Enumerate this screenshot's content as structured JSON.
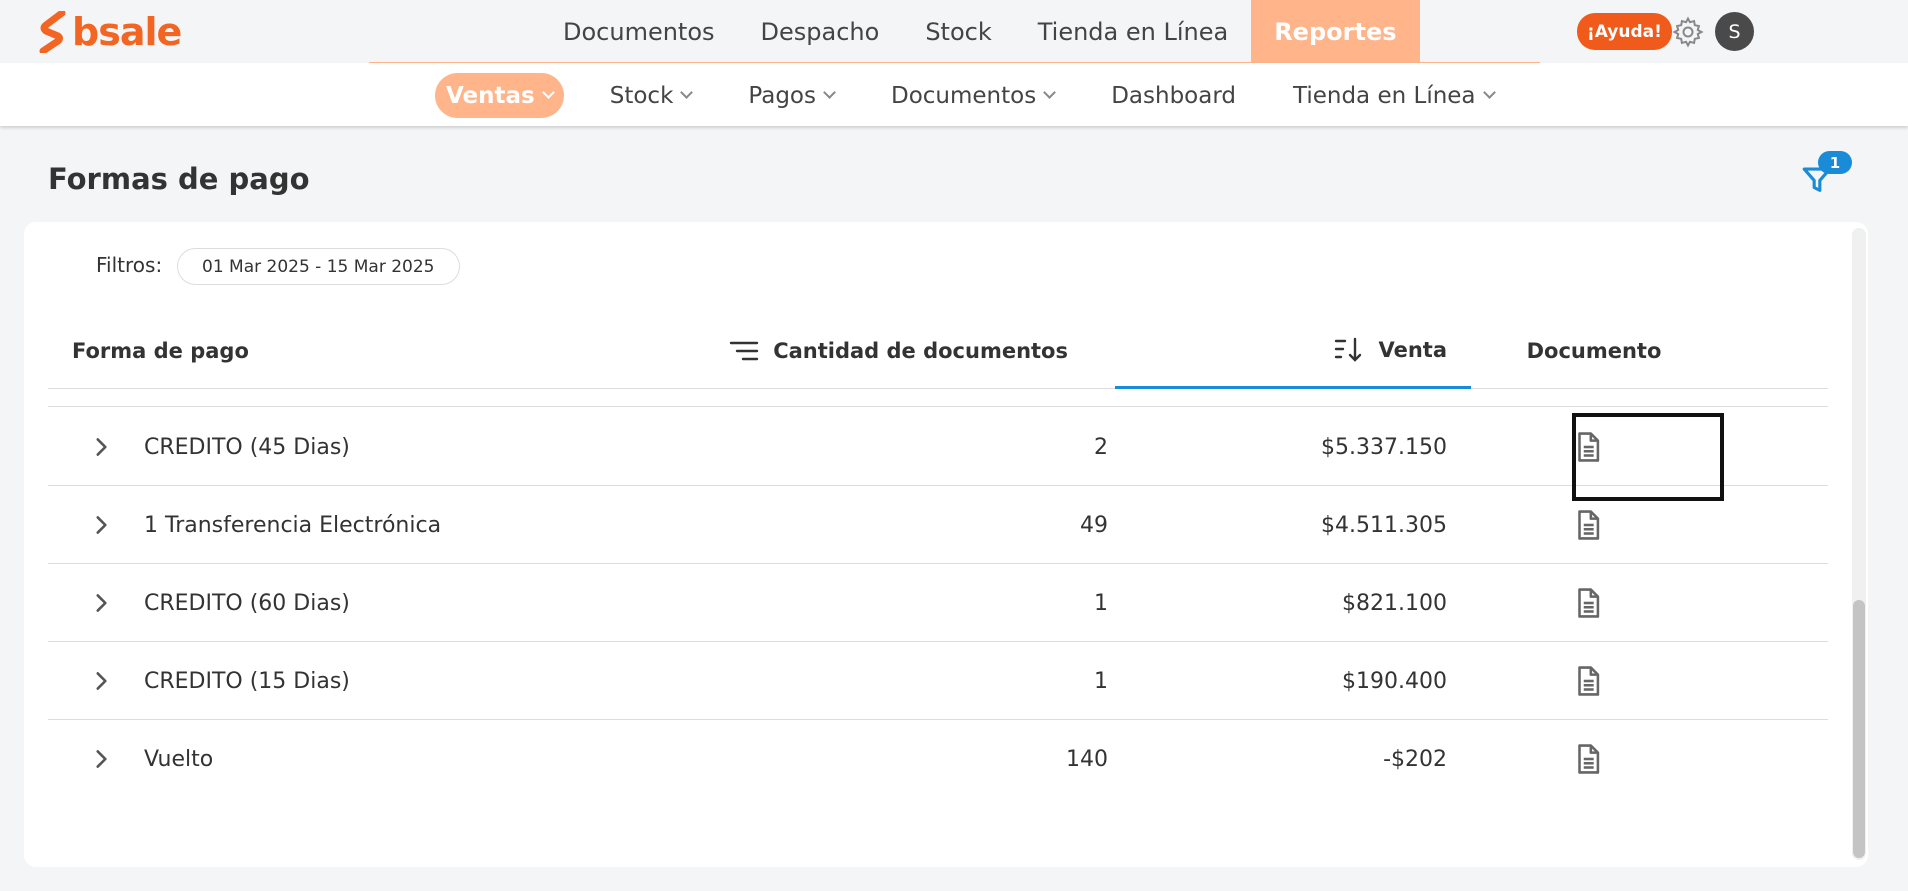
{
  "brand": {
    "name": "bsale",
    "color": "#f26522"
  },
  "main_nav": {
    "items": [
      {
        "label": "Documentos",
        "active": false
      },
      {
        "label": "Despacho",
        "active": false
      },
      {
        "label": "Stock",
        "active": false
      },
      {
        "label": "Tienda en Línea",
        "active": false
      },
      {
        "label": "Reportes",
        "active": true
      }
    ]
  },
  "header_actions": {
    "help_label": "¡Ayuda!",
    "avatar_initial": "S",
    "settings_icon": "gear-icon"
  },
  "sub_nav": {
    "items": [
      {
        "label": "Ventas",
        "active": true,
        "has_dropdown": true
      },
      {
        "label": "Stock",
        "active": false,
        "has_dropdown": true
      },
      {
        "label": "Pagos",
        "active": false,
        "has_dropdown": true
      },
      {
        "label": "Documentos",
        "active": false,
        "has_dropdown": true
      },
      {
        "label": "Dashboard",
        "active": false,
        "has_dropdown": false
      },
      {
        "label": "Tienda en Línea",
        "active": false,
        "has_dropdown": true
      }
    ]
  },
  "page": {
    "title": "Formas de pago",
    "filter_count": "1"
  },
  "filters": {
    "label": "Filtros:",
    "date_range": "01 Mar 2025 - 15 Mar 2025"
  },
  "table": {
    "columns": {
      "forma": "Forma de pago",
      "cantidad": "Cantidad de documentos",
      "venta": "Venta",
      "documento": "Documento"
    },
    "sorted_column": "venta",
    "rows": [
      {
        "forma": "CREDITO (45 Dias)",
        "cantidad": "2",
        "venta": "$5.337.150"
      },
      {
        "forma": "1 Transferencia Electrónica",
        "cantidad": "49",
        "venta": "$4.511.305"
      },
      {
        "forma": "CREDITO (60 Dias)",
        "cantidad": "1",
        "venta": "$821.100"
      },
      {
        "forma": "CREDITO (15 Dias)",
        "cantidad": "1",
        "venta": "$190.400"
      },
      {
        "forma": "Vuelto",
        "cantidad": "140",
        "venta": "-$202"
      }
    ]
  },
  "colors": {
    "accent": "#ffb48a",
    "help": "#f05a1a",
    "blue": "#1a8bd6"
  }
}
